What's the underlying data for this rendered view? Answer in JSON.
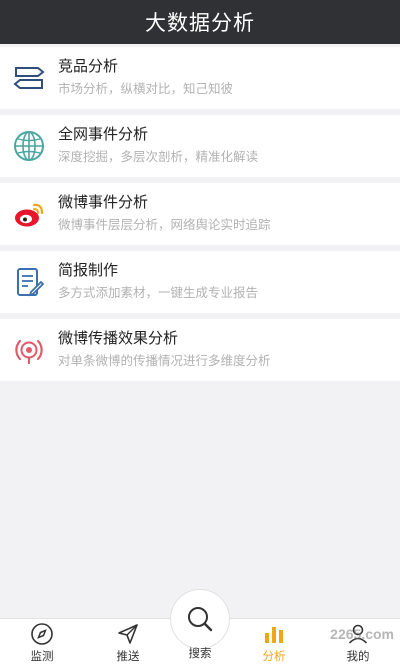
{
  "header": {
    "title": "大数据分析"
  },
  "items": [
    {
      "title": "竞品分析",
      "subtitle": "市场分析，纵横对比，知己知彼",
      "icon": "signpost-icon"
    },
    {
      "title": "全网事件分析",
      "subtitle": "深度挖掘，多层次剖析，精准化解读",
      "icon": "globe-icon"
    },
    {
      "title": "微博事件分析",
      "subtitle": "微博事件层层分析，网络舆论实时追踪",
      "icon": "weibo-icon"
    },
    {
      "title": "简报制作",
      "subtitle": "多方式添加素材，一键生成专业报告",
      "icon": "report-edit-icon"
    },
    {
      "title": "微博传播效果分析",
      "subtitle": "对单条微博的传播情况进行多维度分析",
      "icon": "broadcast-icon"
    }
  ],
  "tabbar": {
    "monitor": "监测",
    "push": "推送",
    "search": "搜索",
    "analysis": "分析",
    "mine": "我的",
    "active": "analysis"
  },
  "watermark": "2265.com",
  "colors": {
    "header_bg": "#2f3135",
    "accent": "#f0a51b",
    "weibo_red": "#e6162d",
    "globe_teal": "#4aa6a0",
    "report_blue": "#3a6fb0",
    "broadcast_red": "#e05a6a"
  }
}
